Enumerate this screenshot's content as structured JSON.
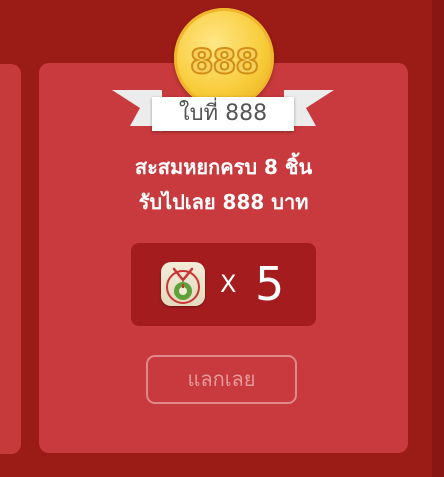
{
  "card": {
    "coin_label": "888",
    "ribbon_text": "ใบที่ 888",
    "description_line1": "สะสมหยกครบ 8 ชิ้น",
    "description_line2": "รับไปเลย 888 บาท",
    "reward": {
      "icon": "jade-pendant-icon",
      "multiplier_symbol": "X",
      "count": "5"
    },
    "redeem_button": "แลกเลย"
  },
  "colors": {
    "background": "#9b1b17",
    "card": "#c83a3d",
    "reward_box": "#a41c1d",
    "coin": "#f8cc3c",
    "button_border": "#e0888a"
  }
}
